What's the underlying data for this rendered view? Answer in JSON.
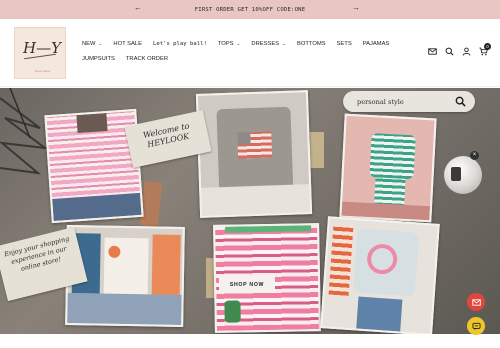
{
  "announcement": {
    "text": "FIRST ORDER GET 10%OFF CODE:ONE",
    "prev_icon": "arrow-left-icon",
    "next_icon": "arrow-right-icon"
  },
  "logo": {
    "mark": "H—Y",
    "sub": "boutique"
  },
  "nav": {
    "row1": [
      {
        "label": "NEW",
        "dropdown": true
      },
      {
        "label": "HOT SALE",
        "dropdown": false
      },
      {
        "label": "Let's play ball!",
        "dropdown": false
      },
      {
        "label": "TOPS",
        "dropdown": true
      },
      {
        "label": "DRESSES",
        "dropdown": true
      },
      {
        "label": "BOTTOMS",
        "dropdown": false
      },
      {
        "label": "SETS",
        "dropdown": false
      },
      {
        "label": "PAJAMAS",
        "dropdown": false
      }
    ],
    "row2": [
      {
        "label": "JUMPSUITS",
        "dropdown": false
      },
      {
        "label": "TRACK ORDER",
        "dropdown": false
      }
    ]
  },
  "header_icons": {
    "icons": [
      "mail-icon",
      "search-icon",
      "account-icon",
      "cart-icon"
    ],
    "cart_count": "0"
  },
  "hero": {
    "search_placeholder": "personal style",
    "note1": "Welcome to HEYLOOK",
    "note2": "Enjoy your shopping experience in our online store!",
    "cta": "SHOP NOW"
  },
  "colors": {
    "announcement_bg": "#e9c6c2",
    "mail_fab": "#e2453c",
    "chat_fab": "#f0c72b"
  }
}
